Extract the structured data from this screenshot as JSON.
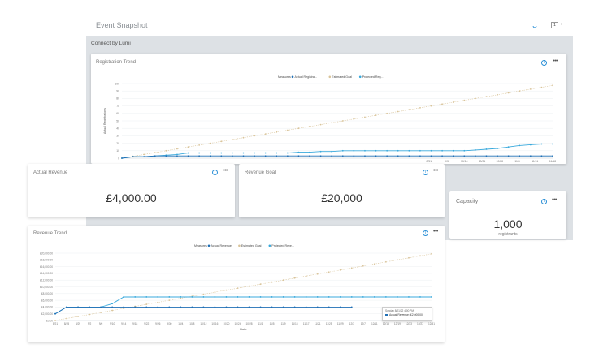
{
  "header": {
    "title": "Event Snapshot",
    "page_indicator": "1"
  },
  "section": {
    "title": "Connect by Lumi"
  },
  "registration_card": {
    "title": "Registration Trend",
    "legend_label": "Measures",
    "legend_items": [
      "Actual Registra...",
      "Estimated Goal",
      "Projected Reg..."
    ],
    "y_axis_label": "Actual Registrations"
  },
  "actual_revenue_card": {
    "title": "Actual Revenue",
    "value": "£4,000.00"
  },
  "revenue_goal_card": {
    "title": "Revenue Goal",
    "value": "£20,000"
  },
  "capacity_card": {
    "title": "Capacity",
    "value": "1,000",
    "unit": "registrants"
  },
  "revenue_card": {
    "title": "Revenue Trend",
    "legend_label": "Measures",
    "legend_items": [
      "Actual Revenue",
      "Estimated Goal",
      "Projected Reve..."
    ],
    "x_axis_label": "Date",
    "tooltip_date": "Sunday 8/21/22 4:00 PM",
    "tooltip_value": "Actual Revenue: £2,000.00"
  },
  "colors": {
    "accent": "#2a8fd6",
    "actual": "#1f6fb5",
    "goal": "#d9c49a",
    "projected": "#39a9dc",
    "panel_gray": "#dde1e5"
  },
  "chart_data": [
    {
      "type": "line",
      "title": "Registration Trend",
      "ylabel": "Actual Registrations",
      "ylim": [
        0,
        100
      ],
      "yticks": [
        "100",
        "90",
        "80",
        "70",
        "60",
        "50",
        "40",
        "30",
        "20",
        "10",
        "0"
      ],
      "xticks_visible": [
        "8/31",
        "9/3",
        "10/14",
        "10/21",
        "10/28",
        "11/4",
        "11/11",
        "11/18"
      ],
      "n": 40,
      "legend": "top-center",
      "series": [
        {
          "name": "Actual Registra...",
          "color": "#1f6fb5",
          "values": [
            0,
            2,
            2,
            3,
            3,
            3,
            3,
            3,
            3,
            3,
            3,
            3,
            3,
            3,
            3,
            3,
            3,
            3,
            3,
            3,
            3,
            3,
            3,
            3,
            3,
            3,
            3,
            3,
            3,
            3,
            3,
            3,
            3,
            3,
            3,
            3,
            3,
            3,
            3,
            3
          ]
        },
        {
          "name": "Estimated Goal",
          "color": "#d9c49a",
          "values": [
            0,
            2.5,
            5,
            7.5,
            10,
            12.5,
            15,
            17.5,
            20,
            22.5,
            25,
            27.5,
            30,
            32.5,
            35,
            37.5,
            40,
            42.5,
            45,
            47.5,
            50,
            52.5,
            55,
            57.5,
            60,
            62.5,
            65,
            67.5,
            70,
            72.5,
            75,
            77.5,
            80,
            82.5,
            85,
            87.5,
            90,
            92.5,
            95,
            97.5
          ]
        },
        {
          "name": "Projected Reg...",
          "color": "#39a9dc",
          "values": [
            0,
            2,
            2,
            3,
            4,
            5,
            7,
            7,
            7,
            7,
            7,
            7,
            7,
            7,
            7,
            7,
            8,
            8,
            9,
            9,
            10,
            10,
            10,
            10,
            10,
            10,
            10,
            10,
            10,
            10,
            10,
            10,
            11,
            12,
            13,
            15,
            17,
            18,
            19,
            19
          ]
        }
      ]
    },
    {
      "type": "line",
      "title": "Revenue Trend",
      "xlabel": "Date",
      "ylim": [
        0,
        20000
      ],
      "yticks": [
        "£20,000.00",
        "£18,000.00",
        "£16,000.00",
        "£14,000.00",
        "£12,000.00",
        "£10,000.00",
        "£8,000.00",
        "£6,000.00",
        "£4,000.00",
        "£2,000.00",
        "£0.00"
      ],
      "xticks": [
        "8/21",
        "8/25",
        "8/29",
        "9/2",
        "9/6",
        "9/10",
        "9/14",
        "9/18",
        "9/22",
        "9/26",
        "9/30",
        "10/4",
        "10/8",
        "10/12",
        "10/16",
        "10/20",
        "10/24",
        "10/28",
        "11/1",
        "11/5",
        "11/9",
        "11/13",
        "11/17",
        "11/21",
        "11/25",
        "11/29",
        "12/3",
        "12/7",
        "12/11",
        "12/15",
        "12/19",
        "12/23",
        "12/27",
        "12/31"
      ],
      "n": 34,
      "legend": "top-center",
      "series": [
        {
          "name": "Actual Revenue",
          "color": "#1f6fb5",
          "values": [
            2000,
            4000,
            4000,
            4000,
            4000,
            4000,
            4000,
            4000,
            4000,
            4000,
            4000,
            4000,
            4000,
            4000,
            4000,
            4000,
            4000,
            4000,
            4000,
            4000,
            4000,
            4000,
            4000,
            4000,
            4000,
            4000,
            4000,
            4000,
            4000,
            4000,
            4000,
            4000,
            4000,
            4000
          ],
          "end": 27
        },
        {
          "name": "Estimated Goal",
          "color": "#d9c49a",
          "values": [
            0,
            600,
            1200,
            1800,
            2400,
            3000,
            3600,
            4200,
            4800,
            5400,
            6000,
            6600,
            7200,
            7800,
            8400,
            9000,
            9600,
            10200,
            10800,
            11400,
            12000,
            12600,
            13200,
            13800,
            14400,
            15000,
            15600,
            16200,
            16800,
            17400,
            18000,
            18600,
            19200,
            19800
          ]
        },
        {
          "name": "Projected Reve...",
          "color": "#39a9dc",
          "values": [
            2000,
            4000,
            4000,
            4000,
            4000,
            5000,
            7000,
            7000,
            7000,
            7000,
            7000,
            7000,
            7000,
            7000,
            7000,
            7000,
            7000,
            7000,
            7000,
            7000,
            7000,
            7000,
            7000,
            7000,
            7000,
            7000,
            7000,
            7000,
            7000,
            7000,
            7000,
            7000,
            7000,
            7000
          ]
        }
      ]
    }
  ]
}
